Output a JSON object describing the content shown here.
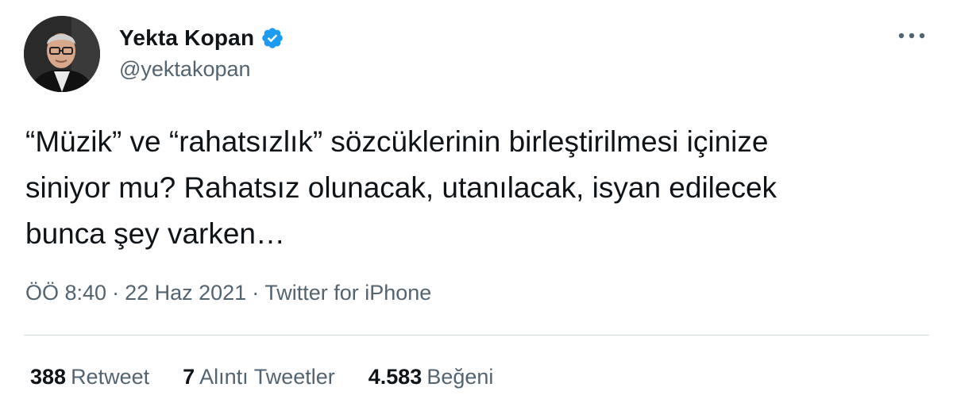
{
  "author": {
    "display_name": "Yekta Kopan",
    "handle": "@yektakopan",
    "verified": true
  },
  "icons": {
    "verified": "verified-badge-icon",
    "more": "more-options-icon"
  },
  "tweet": {
    "text": "“Müzik” ve “rahatsızlık” sözcüklerinin birleştirilmesi içinize\nsiniyor mu? Rahatsız olunacak, utanılacak, isyan edilecek\nbunca şey varken…",
    "time": "ÖÖ 8:40",
    "date": "22 Haz 2021",
    "source": "Twitter for iPhone",
    "separator": "·"
  },
  "stats": {
    "retweets": {
      "count": "388",
      "label": "Retweet"
    },
    "quotes": {
      "count": "7",
      "label": "Alıntı Tweetler"
    },
    "likes": {
      "count": "4.583",
      "label": "Beğeni"
    }
  },
  "colors": {
    "text": "#0f1419",
    "secondary": "#536471",
    "verified": "#1d9bf0",
    "divider": "#cfd9de"
  }
}
